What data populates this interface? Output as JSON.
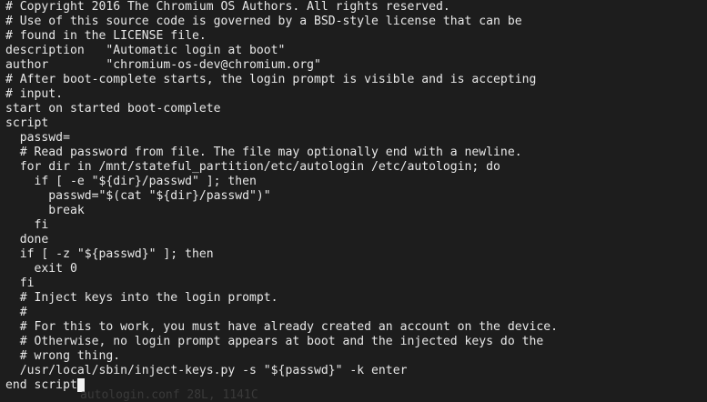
{
  "terminal": {
    "lines": [
      "# Copyright 2016 The Chromium OS Authors. All rights reserved.",
      "# Use of this source code is governed by a BSD-style license that can be",
      "# found in the LICENSE file.",
      "description   \"Automatic login at boot\"",
      "author        \"chromium-os-dev@chromium.org\"",
      "# After boot-complete starts, the login prompt is visible and is accepting",
      "# input.",
      "start on started boot-complete",
      "script",
      "  passwd=",
      "  # Read password from file. The file may optionally end with a newline.",
      "  for dir in /mnt/stateful_partition/etc/autologin /etc/autologin; do",
      "    if [ -e \"${dir}/passwd\" ]; then",
      "      passwd=\"$(cat \"${dir}/passwd\")\"",
      "      break",
      "    fi",
      "  done",
      "  if [ -z \"${passwd}\" ]; then",
      "    exit 0",
      "  fi",
      "  # Inject keys into the login prompt.",
      "  #",
      "  # For this to work, you must have already created an account on the device.",
      "  # Otherwise, no login prompt appears at boot and the injected keys do the",
      "  # wrong thing.",
      "  /usr/local/sbin/inject-keys.py -s \"${passwd}\" -k enter"
    ],
    "last_line": "end script",
    "faint_text": "autologin.conf 28L, 1141C"
  },
  "colors": {
    "background": "#1d1d1d",
    "foreground": "#e8e8e8",
    "cursor": "#f2f2f2"
  }
}
